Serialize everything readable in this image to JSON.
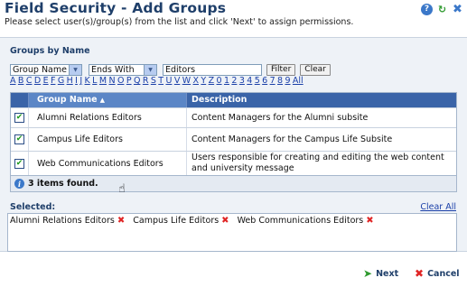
{
  "header": {
    "title": "Field Security - Add Groups",
    "subtitle": "Please select user(s)/group(s) from the list and click 'Next' to assign permissions.",
    "icons": [
      "help-icon",
      "refresh-icon",
      "close-icon"
    ]
  },
  "search": {
    "section_title": "Groups by Name",
    "field_selected": "Group Name",
    "operator_selected": "Ends With",
    "value": "Editors",
    "filter_label": "Filter",
    "clear_label": "Clear",
    "alphabet": [
      "A",
      "B",
      "C",
      "D",
      "E",
      "F",
      "G",
      "H",
      "I",
      "J",
      "K",
      "L",
      "M",
      "N",
      "O",
      "P",
      "Q",
      "R",
      "S",
      "T",
      "U",
      "V",
      "W",
      "X",
      "Y",
      "Z",
      "0",
      "1",
      "2",
      "3",
      "4",
      "5",
      "6",
      "7",
      "8",
      "9",
      "All"
    ]
  },
  "grid": {
    "columns": [
      "Group Name",
      "Description"
    ],
    "rows": [
      {
        "name": "Alumni Relations Editors",
        "description": "Content Managers for the Alumni subsite",
        "checked": true
      },
      {
        "name": "Campus Life Editors",
        "description": "Content Managers for the Campus Life Subsite",
        "checked": true
      },
      {
        "name": "Web Communications Editors",
        "description": "Users responsible for creating and editing the web content and university message",
        "checked": true
      }
    ],
    "status": "3 items found."
  },
  "selected": {
    "label": "Selected:",
    "clear_all": "Clear All",
    "items": [
      "Alumni Relations Editors",
      "Campus Life Editors",
      "Web Communications Editors"
    ]
  },
  "footer": {
    "next_label": "Next",
    "cancel_label": "Cancel"
  }
}
